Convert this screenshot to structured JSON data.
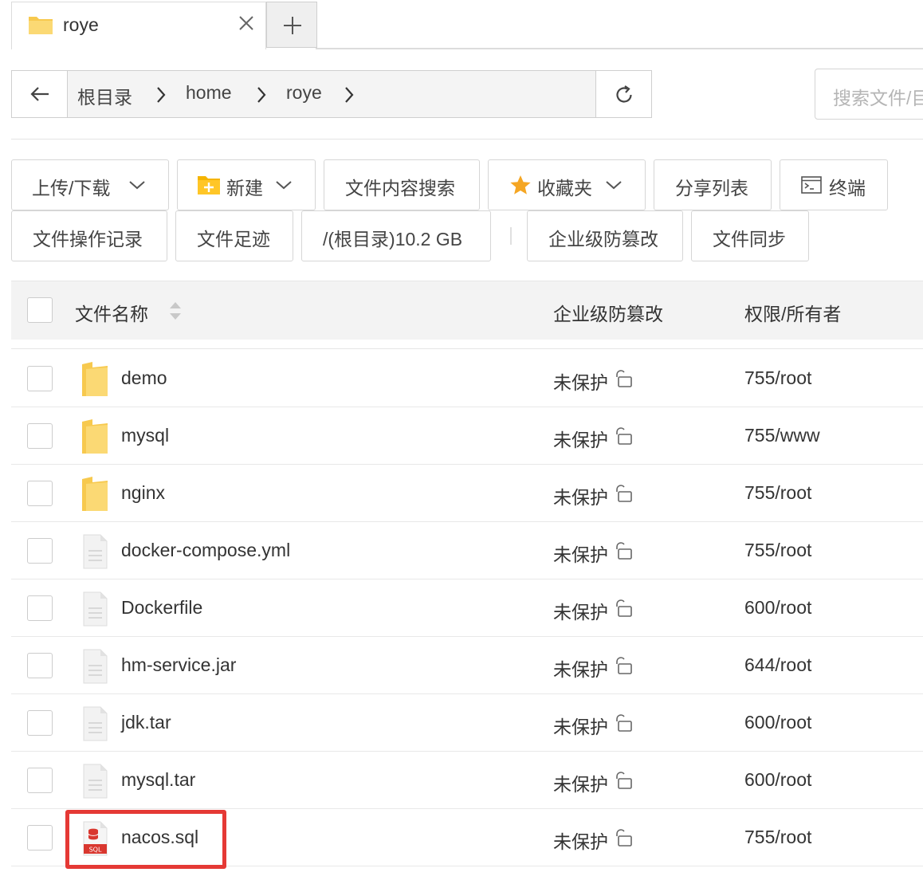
{
  "tab": {
    "label": "roye",
    "add_symbol": "+"
  },
  "path": {
    "crumbs": [
      "根目录",
      "home",
      "roye"
    ]
  },
  "search": {
    "placeholder": "搜索文件/目录"
  },
  "toolbar": {
    "upload_download": "上传/下载",
    "new": "新建",
    "content_search": "文件内容搜索",
    "favorites": "收藏夹",
    "share_list": "分享列表",
    "terminal": "终端",
    "operation_log": "文件操作记录",
    "footprint": "文件足迹",
    "disk_usage": "/(根目录)10.2 GB",
    "tamper_proof": "企业级防篡改",
    "file_sync": "文件同步"
  },
  "table": {
    "headers": {
      "name": "文件名称",
      "protection": "企业级防篡改",
      "permission": "权限/所有者"
    },
    "rows": [
      {
        "name": "demo",
        "type": "folder",
        "protection": "未保护",
        "permission": "755/root"
      },
      {
        "name": "mysql",
        "type": "folder",
        "protection": "未保护",
        "permission": "755/www"
      },
      {
        "name": "nginx",
        "type": "folder",
        "protection": "未保护",
        "permission": "755/root"
      },
      {
        "name": "docker-compose.yml",
        "type": "file",
        "protection": "未保护",
        "permission": "755/root"
      },
      {
        "name": "Dockerfile",
        "type": "file",
        "protection": "未保护",
        "permission": "600/root"
      },
      {
        "name": "hm-service.jar",
        "type": "file",
        "protection": "未保护",
        "permission": "644/root"
      },
      {
        "name": "jdk.tar",
        "type": "file",
        "protection": "未保护",
        "permission": "600/root"
      },
      {
        "name": "mysql.tar",
        "type": "file",
        "protection": "未保护",
        "permission": "600/root"
      },
      {
        "name": "nacos.sql",
        "type": "sql",
        "protection": "未保护",
        "permission": "755/root",
        "sql_badge": "SQL"
      }
    ]
  },
  "colors": {
    "folder": "#f9d66b",
    "highlight": "#e53935",
    "star": "#f5a623",
    "new_folder": "#f5b400"
  },
  "icons": {
    "tab": "folder-icon",
    "close": "close-icon",
    "add": "plus-icon",
    "back": "arrow-left-icon",
    "refresh": "refresh-icon",
    "terminal": "terminal-icon",
    "favorites": "star-icon",
    "sort": "sort-icon",
    "lock": "unlock-icon"
  }
}
